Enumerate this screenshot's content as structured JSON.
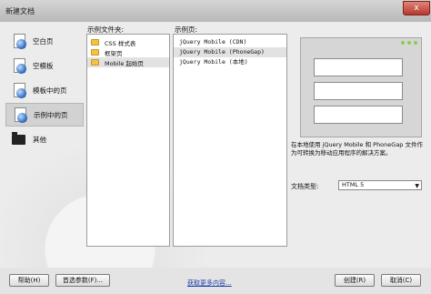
{
  "window": {
    "title": "新建文档",
    "close_label": "x"
  },
  "sidebar": {
    "items": [
      {
        "label": "空白页",
        "icon": "blank-page-icon"
      },
      {
        "label": "空模板",
        "icon": "blank-template-icon"
      },
      {
        "label": "模板中的页",
        "icon": "template-page-icon"
      },
      {
        "label": "示例中的页",
        "icon": "sample-page-icon"
      },
      {
        "label": "其他",
        "icon": "other-folder-icon"
      }
    ]
  },
  "folders": {
    "header": "示例文件夹:",
    "items": [
      "CSS 样式表",
      "框架页",
      "Mobile 起始页"
    ],
    "selected_index": 2
  },
  "pages": {
    "header": "示例页:",
    "items": [
      "jQuery Mobile (CDN)",
      "jQuery Mobile (PhoneGap)",
      "jQuery Mobile (本地)"
    ],
    "selected_index": 1
  },
  "description": "在本地使用 jQuery Mobile 和 PhoneGap 文件作为可转换为移动应用程序的解决方案。",
  "doctype": {
    "label": "文档类型:",
    "value": "HTML 5"
  },
  "buttons": {
    "help": "帮助(H)",
    "preferences": "首选参数(F)...",
    "more_content": "获取更多内容...",
    "create": "创建(R)",
    "cancel": "取消(C)"
  },
  "colors": {
    "preview_dot": "#8ad04f",
    "link": "#1a3fa8"
  }
}
